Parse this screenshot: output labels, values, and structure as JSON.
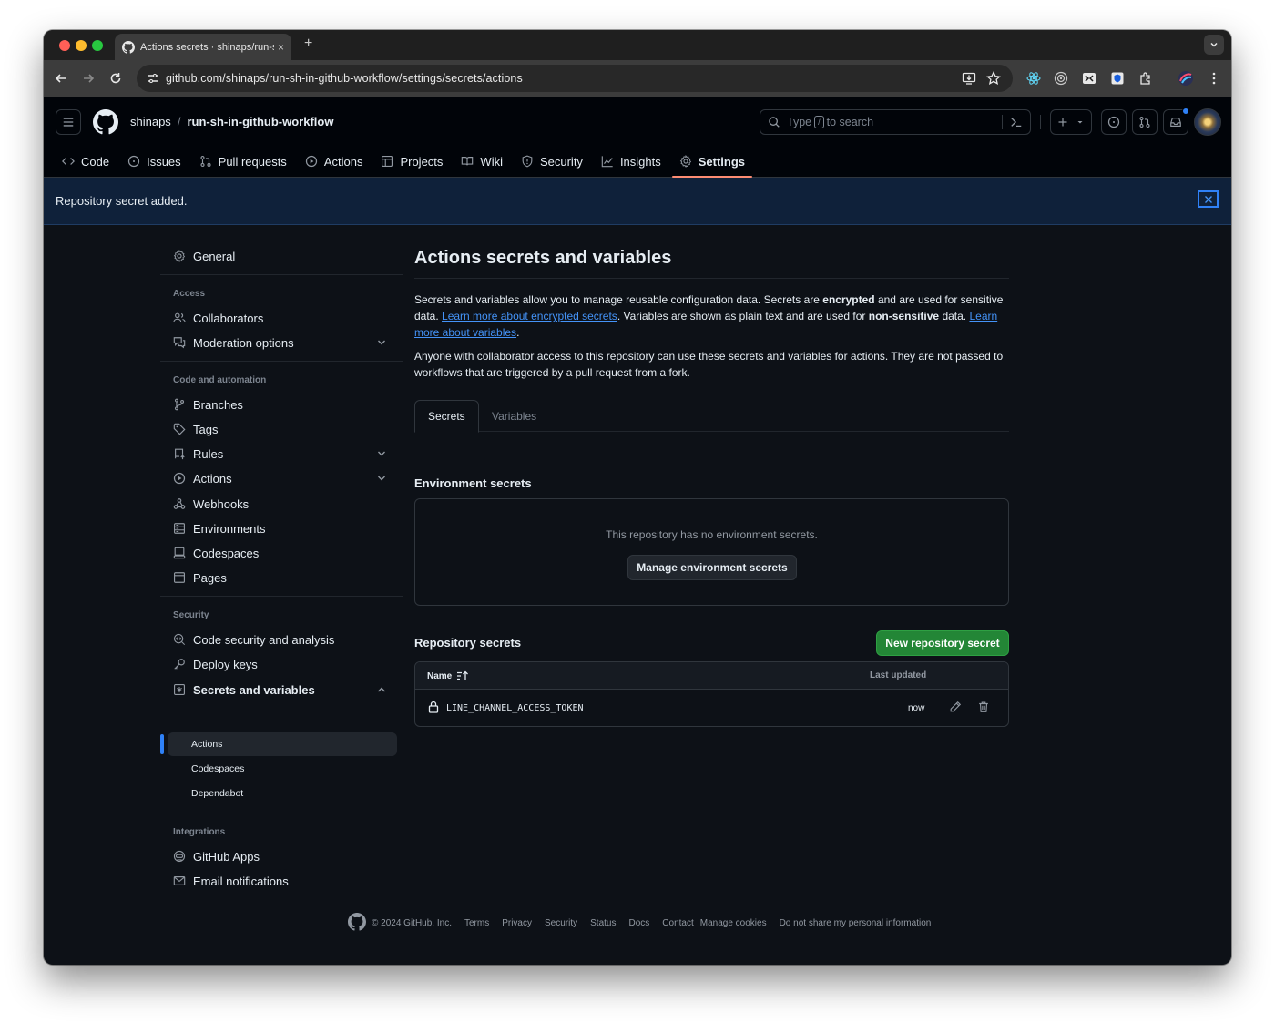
{
  "browser": {
    "tab_title": "Actions secrets · shinaps/run-sh-in-github-workflow",
    "tab_close": "×",
    "new_tab": "+",
    "url": "github.com/shinaps/run-sh-in-github-workflow/settings/secrets/actions"
  },
  "header": {
    "owner": "shinaps",
    "separator": "/",
    "repo": "run-sh-in-github-workflow",
    "search_prefix": "Type",
    "search_key": "/",
    "search_suffix": "to search"
  },
  "repo_nav": [
    {
      "label": "Code",
      "icon": "code-icon"
    },
    {
      "label": "Issues",
      "icon": "issue-icon"
    },
    {
      "label": "Pull requests",
      "icon": "pull-request-icon"
    },
    {
      "label": "Actions",
      "icon": "play-icon"
    },
    {
      "label": "Projects",
      "icon": "table-icon"
    },
    {
      "label": "Wiki",
      "icon": "book-icon"
    },
    {
      "label": "Security",
      "icon": "shield-icon"
    },
    {
      "label": "Insights",
      "icon": "graph-icon"
    },
    {
      "label": "Settings",
      "icon": "gear-icon",
      "selected": true
    }
  ],
  "flash": {
    "message": "Repository secret added."
  },
  "sidebar": {
    "general": "General",
    "groups": {
      "access": "Access",
      "code_automation": "Code and automation",
      "security": "Security",
      "integrations": "Integrations"
    },
    "items": {
      "collaborators": "Collaborators",
      "moderation": "Moderation options",
      "branches": "Branches",
      "tags": "Tags",
      "rules": "Rules",
      "actions": "Actions",
      "webhooks": "Webhooks",
      "environments": "Environments",
      "codespaces": "Codespaces",
      "pages": "Pages",
      "code_security": "Code security and analysis",
      "deploy_keys": "Deploy keys",
      "secrets_variables": "Secrets and variables",
      "sub_actions": "Actions",
      "sub_codespaces": "Codespaces",
      "sub_dependabot": "Dependabot",
      "github_apps": "GitHub Apps",
      "email_notifications": "Email notifications"
    }
  },
  "main": {
    "title": "Actions secrets and variables",
    "desc1_a": "Secrets and variables allow you to manage reusable configuration data. Secrets are ",
    "desc1_b": "encrypted",
    "desc1_c": " and are used for sensitive data. ",
    "desc1_link1": "Learn more about encrypted secrets",
    "desc1_d": ". Variables are shown as plain text and are used for ",
    "desc1_e": "non-sensitive",
    "desc1_f": " data. ",
    "desc1_link2": "Learn more about variables",
    "desc1_g": ".",
    "desc2": "Anyone with collaborator access to this repository can use these secrets and variables for actions. They are not passed to workflows that are triggered by a pull request from a fork.",
    "tabs": [
      "Secrets",
      "Variables"
    ],
    "env_heading": "Environment secrets",
    "env_empty": "This repository has no environment secrets.",
    "env_button": "Manage environment secrets",
    "repo_heading": "Repository secrets",
    "new_secret_button": "New repository secret",
    "table": {
      "col_name": "Name",
      "col_updated": "Last updated",
      "rows": [
        {
          "name": "LINE_CHANNEL_ACCESS_TOKEN",
          "updated": "now"
        }
      ]
    }
  },
  "footer": {
    "copyright": "© 2024 GitHub, Inc.",
    "links": [
      "Terms",
      "Privacy",
      "Security",
      "Status",
      "Docs",
      "Contact",
      "Manage cookies",
      "Do not share my personal information"
    ]
  },
  "colors": {
    "accent_blue": "#2f81f7",
    "link_blue": "#4493f8",
    "green_button": "#238636",
    "selected_underline": "#fd8c73",
    "bg": "#0d1117"
  }
}
